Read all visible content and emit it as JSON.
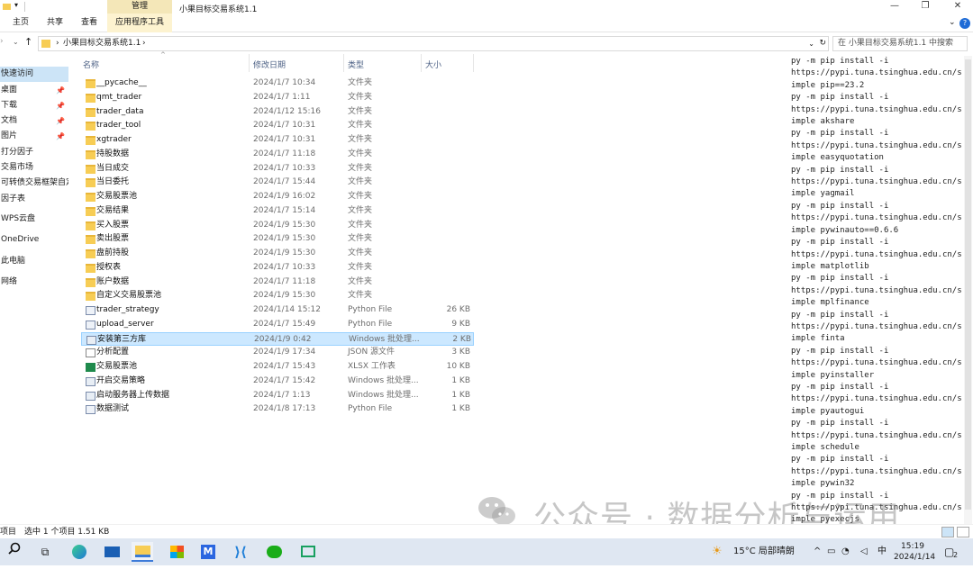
{
  "ribbon": {
    "context_group": "管理",
    "tabs": [
      "主页",
      "共享",
      "查看"
    ],
    "context_tab": "应用程序工具",
    "window_title": "小果目标交易系统1.1"
  },
  "address": {
    "path": "小果目标交易系统1.1",
    "search_placeholder": "在 小果目标交易系统1.1 中搜索"
  },
  "nav": {
    "items": [
      {
        "label": "快速访问",
        "pinned": false,
        "selected": true
      },
      {
        "label": "桌面",
        "pinned": true
      },
      {
        "label": "下载",
        "pinned": true
      },
      {
        "label": "文档",
        "pinned": true
      },
      {
        "label": "图片",
        "pinned": true
      },
      {
        "label": "打分因子",
        "pinned": false
      },
      {
        "label": "交易市场",
        "pinned": false
      },
      {
        "label": "可转债交易框架自定",
        "pinned": false
      },
      {
        "label": "因子表",
        "pinned": false
      },
      {
        "label": "WPS云盘",
        "pinned": false
      },
      {
        "label": "OneDrive",
        "pinned": false
      },
      {
        "label": "此电脑",
        "pinned": false
      },
      {
        "label": "网络",
        "pinned": false
      }
    ]
  },
  "columns": {
    "name": "名称",
    "date": "修改日期",
    "type": "类型",
    "size": "大小"
  },
  "files": [
    {
      "name": "__pycache__",
      "date": "2024/1/7 10:34",
      "type": "文件夹",
      "size": "",
      "icon": "folder"
    },
    {
      "name": "qmt_trader",
      "date": "2024/1/7 1:11",
      "type": "文件夹",
      "size": "",
      "icon": "folder"
    },
    {
      "name": "trader_data",
      "date": "2024/1/12 15:16",
      "type": "文件夹",
      "size": "",
      "icon": "folder"
    },
    {
      "name": "trader_tool",
      "date": "2024/1/7 10:31",
      "type": "文件夹",
      "size": "",
      "icon": "folder"
    },
    {
      "name": "xgtrader",
      "date": "2024/1/7 10:31",
      "type": "文件夹",
      "size": "",
      "icon": "folder"
    },
    {
      "name": "持股数据",
      "date": "2024/1/7 11:18",
      "type": "文件夹",
      "size": "",
      "icon": "folder"
    },
    {
      "name": "当日成交",
      "date": "2024/1/7 10:33",
      "type": "文件夹",
      "size": "",
      "icon": "folder"
    },
    {
      "name": "当日委托",
      "date": "2024/1/7 15:44",
      "type": "文件夹",
      "size": "",
      "icon": "folder"
    },
    {
      "name": "交易股票池",
      "date": "2024/1/9 16:02",
      "type": "文件夹",
      "size": "",
      "icon": "folder"
    },
    {
      "name": "交易结果",
      "date": "2024/1/7 15:14",
      "type": "文件夹",
      "size": "",
      "icon": "folder"
    },
    {
      "name": "买入股票",
      "date": "2024/1/9 15:30",
      "type": "文件夹",
      "size": "",
      "icon": "folder"
    },
    {
      "name": "卖出股票",
      "date": "2024/1/9 15:30",
      "type": "文件夹",
      "size": "",
      "icon": "folder"
    },
    {
      "name": "盘前持股",
      "date": "2024/1/9 15:30",
      "type": "文件夹",
      "size": "",
      "icon": "folder"
    },
    {
      "name": "授权表",
      "date": "2024/1/7 10:33",
      "type": "文件夹",
      "size": "",
      "icon": "folder"
    },
    {
      "name": "账户数据",
      "date": "2024/1/7 11:18",
      "type": "文件夹",
      "size": "",
      "icon": "folder"
    },
    {
      "name": "自定义交易股票池",
      "date": "2024/1/9 15:30",
      "type": "文件夹",
      "size": "",
      "icon": "folder"
    },
    {
      "name": "trader_strategy",
      "date": "2024/1/14 15:12",
      "type": "Python File",
      "size": "26 KB",
      "icon": "py"
    },
    {
      "name": "upload_server",
      "date": "2024/1/7 15:49",
      "type": "Python File",
      "size": "9 KB",
      "icon": "py"
    },
    {
      "name": "安装第三方库",
      "date": "2024/1/9 0:42",
      "type": "Windows 批处理...",
      "size": "2 KB",
      "icon": "bat",
      "selected": true
    },
    {
      "name": "分析配置",
      "date": "2024/1/9 17:34",
      "type": "JSON 源文件",
      "size": "3 KB",
      "icon": "json"
    },
    {
      "name": "交易股票池",
      "date": "2024/1/7 15:43",
      "type": "XLSX 工作表",
      "size": "10 KB",
      "icon": "xlsx"
    },
    {
      "name": "开启交易策略",
      "date": "2024/1/7 15:42",
      "type": "Windows 批处理...",
      "size": "1 KB",
      "icon": "bat"
    },
    {
      "name": "启动服务器上传数据",
      "date": "2024/1/7 1:13",
      "type": "Windows 批处理...",
      "size": "1 KB",
      "icon": "bat"
    },
    {
      "name": "数据测试",
      "date": "2024/1/8 17:13",
      "type": "Python File",
      "size": "1 KB",
      "icon": "py"
    }
  ],
  "terminal": {
    "lines": [
      "py -m pip install -i",
      "https://pypi.tuna.tsinghua.edu.cn/s",
      "imple pip==23.2",
      "py -m pip install -i",
      "https://pypi.tuna.tsinghua.edu.cn/s",
      "imple akshare",
      "py -m pip install -i",
      "https://pypi.tuna.tsinghua.edu.cn/s",
      "imple easyquotation",
      "py -m pip install -i",
      "https://pypi.tuna.tsinghua.edu.cn/s",
      "imple yagmail",
      "py -m pip install -i",
      "https://pypi.tuna.tsinghua.edu.cn/s",
      "imple pywinauto==0.6.6",
      "py -m pip install -i",
      "https://pypi.tuna.tsinghua.edu.cn/s",
      "imple matplotlib",
      "py -m pip install -i",
      "https://pypi.tuna.tsinghua.edu.cn/s",
      "imple mplfinance",
      "py -m pip install -i",
      "https://pypi.tuna.tsinghua.edu.cn/s",
      "imple finta",
      "py -m pip install -i",
      "https://pypi.tuna.tsinghua.edu.cn/s",
      "imple pyinstaller",
      "py -m pip install -i",
      "https://pypi.tuna.tsinghua.edu.cn/s",
      "imple pyautogui",
      "py -m pip install -i",
      "https://pypi.tuna.tsinghua.edu.cn/s",
      "imple schedule",
      "py -m pip install -i",
      "https://pypi.tuna.tsinghua.edu.cn/s",
      "imple pywin32",
      "py -m pip install -i",
      "https://pypi.tuna.tsinghua.edu.cn/s",
      "imple pyexecjs"
    ]
  },
  "watermark": "公众号 · 数据分析与运用",
  "status": {
    "items_suffix": "项目",
    "selection": "选中 1 个项目  1.51 KB"
  },
  "taskbar": {
    "weather": "15°C 局部晴朗",
    "ime": "中",
    "time": "15:19",
    "date": "2024/1/14",
    "notifications": "2"
  },
  "colors": {
    "selection": "#cce8ff",
    "folder": "#f7cd55",
    "accent": "#1e6bd6"
  }
}
